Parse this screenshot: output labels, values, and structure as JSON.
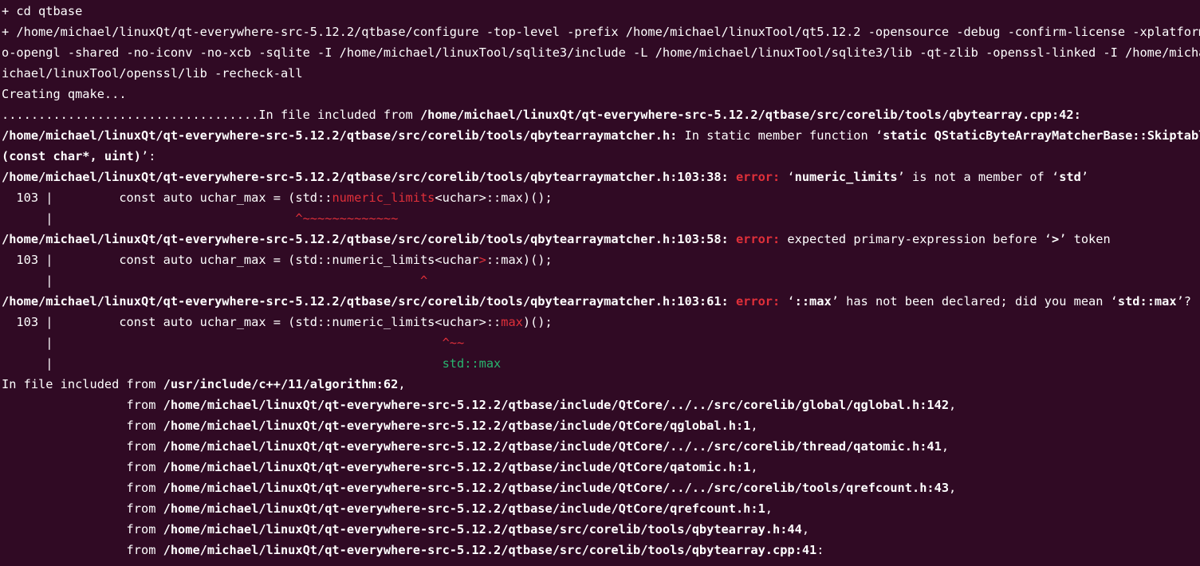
{
  "colors": {
    "background": "#300a24",
    "foreground": "#ffffff",
    "error_red": "#e0303a",
    "fixit_green": "#28b56e"
  },
  "terminal": {
    "l01": "+ cd qtbase",
    "l02": "+ /home/michael/linuxQt/qt-everywhere-src-5.12.2/qtbase/configure -top-level -prefix /home/michael/linuxTool/qt5.12.2 -opensource -debug -confirm-license -xplatform li",
    "l03": "o-opengl -shared -no-iconv -no-xcb -sqlite -I /home/michael/linuxTool/sqlite3/include -L /home/michael/linuxTool/sqlite3/lib -qt-zlib -openssl-linked -I /home/michael/",
    "l04": "ichael/linuxTool/openssl/lib -recheck-all",
    "l05": "Creating qmake...",
    "l06_dots": "...................................In file included from ",
    "l06_path": "/home/michael/linuxQt/qt-everywhere-src-5.12.2/qtbase/src/corelib/tools/qbytearray.cpp:42",
    "l06_tail": ":",
    "l07_path": "/home/michael/linuxQt/qt-everywhere-src-5.12.2/qtbase/src/corelib/tools/qbytearraymatcher.h:",
    "l07_mid": " In static member function ‘",
    "l07_sig": "static QStaticByteArrayMatcherBase::Skiptable Q",
    "l08": "(const char*, uint)",
    "l08_tail": "’:",
    "l09_path": "/home/michael/linuxQt/qt-everywhere-src-5.12.2/qtbase/src/corelib/tools/qbytearraymatcher.h:103:38:",
    "l09_err": " error:",
    "l09_msg1": " ‘",
    "l09_sym1": "numeric_limits",
    "l09_msg2": "’ is not a member of ‘",
    "l09_sym2": "std",
    "l09_msg3": "’",
    "l10_pre": "  103 |         const auto uchar_max = (std::",
    "l10_hl": "numeric_limits",
    "l10_post": "<uchar>::max)();",
    "l11_pre": "      |                                 ",
    "l11_hl": "^~~~~~~~~~~~~~",
    "l12_path": "/home/michael/linuxQt/qt-everywhere-src-5.12.2/qtbase/src/corelib/tools/qbytearraymatcher.h:103:58:",
    "l12_err": " error:",
    "l12_msg1": " expected primary-expression before ‘",
    "l12_sym": ">",
    "l12_msg2": "’ token",
    "l13_pre": "  103 |         const auto uchar_max = (std::numeric_limits<uchar",
    "l13_hl": ">",
    "l13_post": "::max)();",
    "l14_pre": "      |                                                  ",
    "l14_hl": "^",
    "l15_path": "/home/michael/linuxQt/qt-everywhere-src-5.12.2/qtbase/src/corelib/tools/qbytearraymatcher.h:103:61:",
    "l15_err": " error:",
    "l15_msg1": " ‘",
    "l15_sym1": "::max",
    "l15_msg2": "’ has not been declared; did you mean ‘",
    "l15_sym2": "std::max",
    "l15_msg3": "’?",
    "l16_pre": "  103 |         const auto uchar_max = (std::numeric_limits<uchar>::",
    "l16_hl": "max",
    "l16_post": ")();",
    "l17_pre": "      |                                                     ",
    "l17_hl": "^~~",
    "l18_pre": "      |                                                     ",
    "l18_hl": "std::max",
    "l19_pre": "In file included from ",
    "l19_path": "/usr/include/c++/11/algorithm:62",
    "l19_tail": ",",
    "from_prefix": "                 from ",
    "from_lines": [
      {
        "path": "/home/michael/linuxQt/qt-everywhere-src-5.12.2/qtbase/include/QtCore/../../src/corelib/global/qglobal.h:142",
        "tail": ","
      },
      {
        "path": "/home/michael/linuxQt/qt-everywhere-src-5.12.2/qtbase/include/QtCore/qglobal.h:1",
        "tail": ","
      },
      {
        "path": "/home/michael/linuxQt/qt-everywhere-src-5.12.2/qtbase/include/QtCore/../../src/corelib/thread/qatomic.h:41",
        "tail": ","
      },
      {
        "path": "/home/michael/linuxQt/qt-everywhere-src-5.12.2/qtbase/include/QtCore/qatomic.h:1",
        "tail": ","
      },
      {
        "path": "/home/michael/linuxQt/qt-everywhere-src-5.12.2/qtbase/include/QtCore/../../src/corelib/tools/qrefcount.h:43",
        "tail": ","
      },
      {
        "path": "/home/michael/linuxQt/qt-everywhere-src-5.12.2/qtbase/include/QtCore/qrefcount.h:1",
        "tail": ","
      },
      {
        "path": "/home/michael/linuxQt/qt-everywhere-src-5.12.2/qtbase/src/corelib/tools/qbytearray.h:44",
        "tail": ","
      },
      {
        "path": "/home/michael/linuxQt/qt-everywhere-src-5.12.2/qtbase/src/corelib/tools/qbytearray.cpp:41",
        "tail": ":"
      }
    ]
  }
}
